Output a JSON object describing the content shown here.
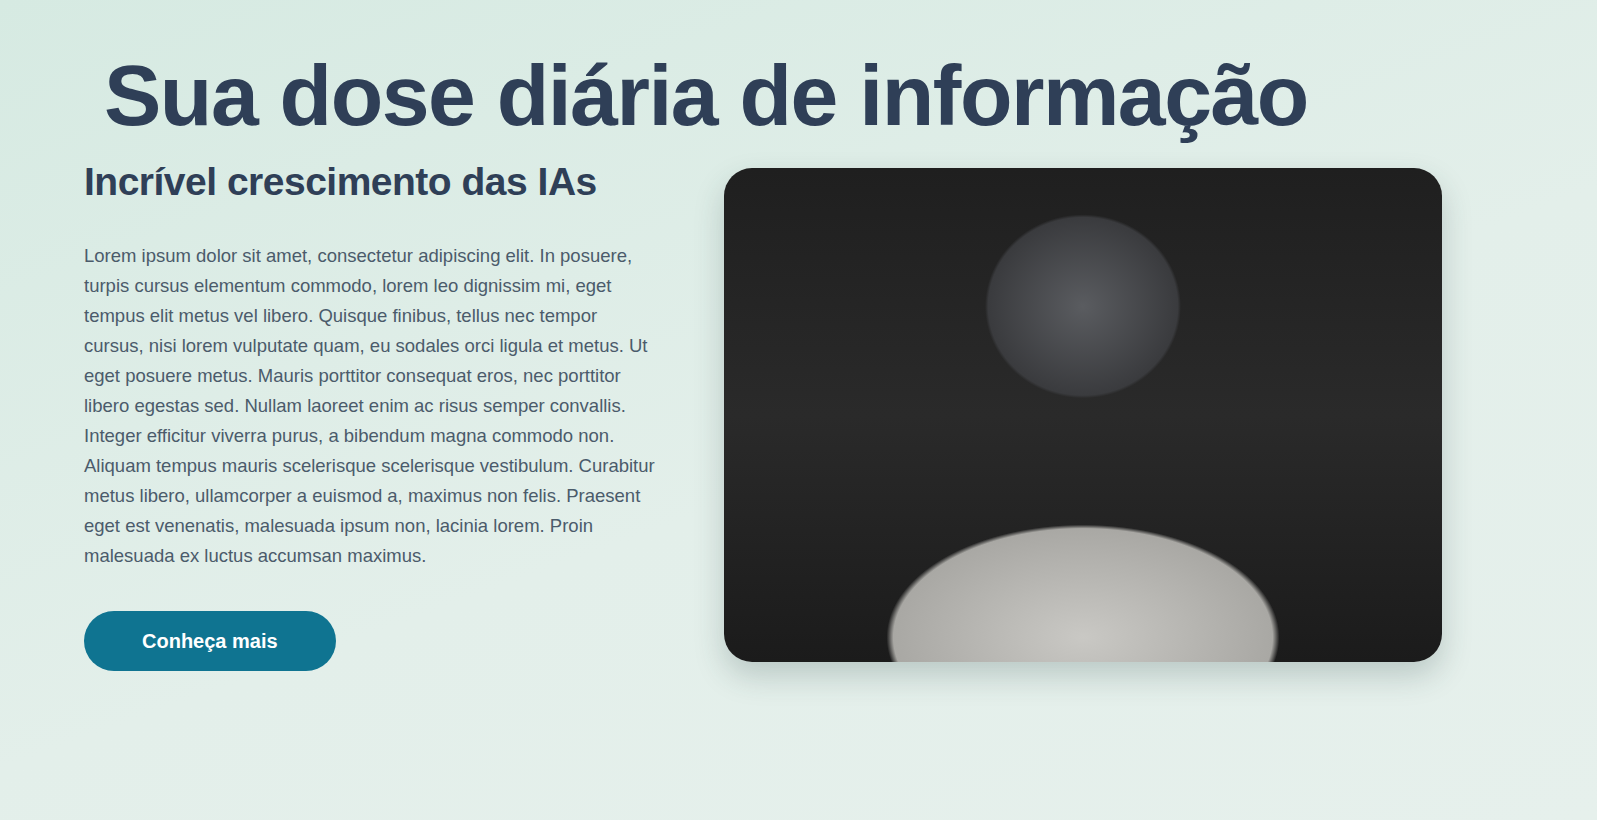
{
  "page": {
    "title": "Sua dose diária de informação"
  },
  "article": {
    "title": "Incrível crescimento das IAs",
    "body": "Lorem ipsum dolor sit amet, consectetur adipiscing elit. In posuere, turpis cursus elementum commodo, lorem leo dignissim mi, eget tempus elit metus vel libero. Quisque finibus, tellus nec tempor cursus, nisi lorem vulputate quam, eu sodales orci ligula et metus. Ut eget posuere metus. Mauris porttitor consequat eros, nec porttitor libero egestas sed. Nullam laoreet enim ac risus semper convallis. Integer efficitur viverra purus, a bibendum magna commodo non. Aliquam tempus mauris scelerisque scelerisque vestibulum. Curabitur metus libero, ullamcorper a euismod a, maximus non felis. Praesent eget est venenatis, malesuada ipsum non, lacinia lorem. Proin malesuada ex luctus accumsan maximus.",
    "button": "Conheça mais"
  }
}
